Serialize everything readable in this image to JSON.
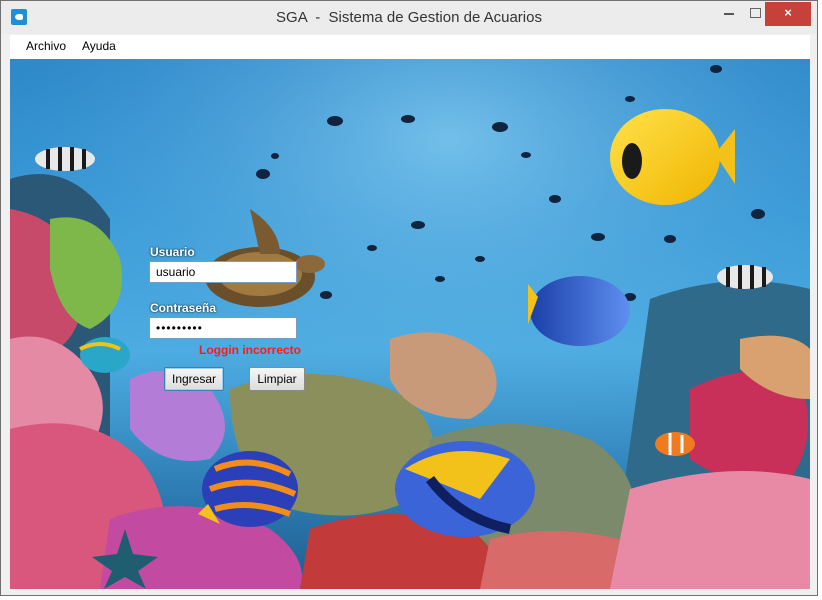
{
  "window": {
    "title": "SGA  -  Sistema de Gestion de Acuarios",
    "close_glyph": "×"
  },
  "menubar": {
    "items": [
      {
        "label": "Archivo"
      },
      {
        "label": "Ayuda"
      }
    ]
  },
  "login": {
    "username_label": "Usuario",
    "username_value": "usuario",
    "password_label": "Contraseña",
    "password_value": "•••••••••",
    "error_message": "Loggin incorrecto",
    "submit_label": "Ingresar",
    "clear_label": "Limpiar"
  },
  "colors": {
    "error": "#ff1a1a",
    "close_button": "#c7413b",
    "water": "#3a9bd8"
  },
  "icons": {
    "app": "fish-app-icon",
    "minimize": "minimize-icon",
    "maximize": "maximize-icon",
    "close": "close-icon"
  }
}
